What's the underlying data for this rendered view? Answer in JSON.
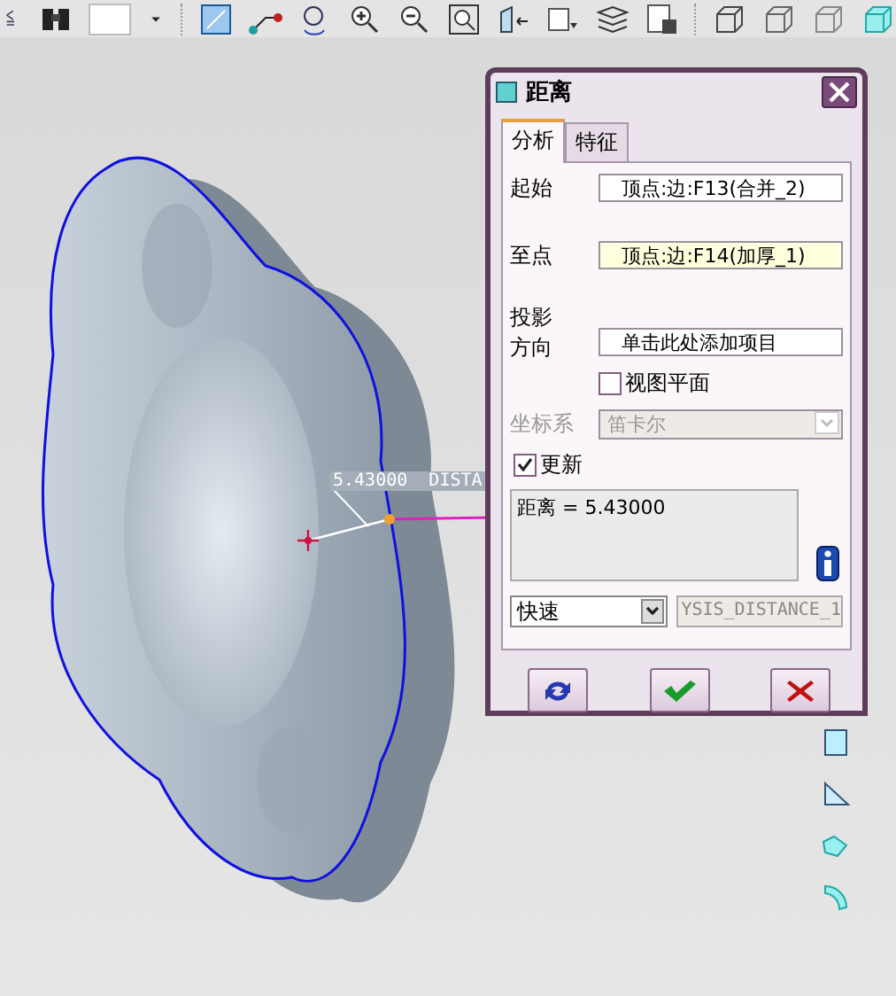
{
  "viewport": {
    "dimension_label": "5.43000  DISTA"
  },
  "dialog": {
    "title": "距离",
    "tabs": [
      {
        "label": "分析",
        "selected": true
      },
      {
        "label": "特征",
        "selected": false
      }
    ],
    "fields": [
      {
        "label": "起始",
        "value": "顶点:边:F13(合并_2)",
        "active": false
      },
      {
        "label": "至点",
        "value": "顶点:边:F14(加厚_1)",
        "active": true
      }
    ],
    "projection": {
      "label_lines": [
        "投影",
        "方向"
      ],
      "value": "单击此处添加项目"
    },
    "view_plane": {
      "label": "视图平面",
      "checked": false
    },
    "coordinate_system": {
      "label": "坐标系",
      "value": "笛卡尔",
      "disabled": true
    },
    "update": {
      "label": "更新",
      "checked": true
    },
    "result": "距离 = 5.43000",
    "mode": "快速",
    "analysis_name": "YSIS_DISTANCE_1",
    "buttons": [
      {
        "kind": "repeat"
      },
      {
        "kind": "ok"
      },
      {
        "kind": "cancel"
      }
    ]
  }
}
